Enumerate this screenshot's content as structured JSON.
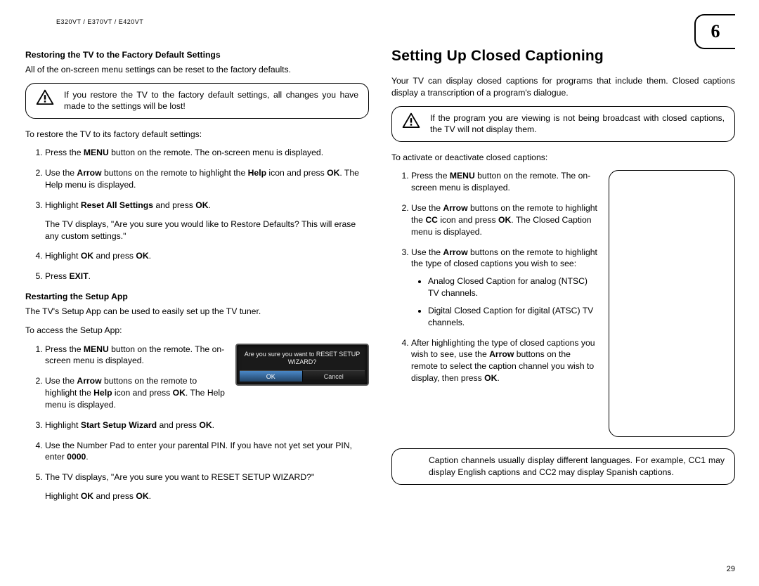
{
  "header": {
    "model": "E320VT / E370VT / E420VT"
  },
  "chapter_number": "6",
  "page_number": "29",
  "left": {
    "sub1": "Restoring the TV to the Factory Default Settings",
    "p1": "All of the on-screen menu settings can be reset to the factory defaults.",
    "warn1": "If you restore the TV to the factory default settings, all changes you have made to the settings will be lost!",
    "p2": "To restore the TV to its factory default settings:",
    "s1_a": "Press the ",
    "s1_menu": "MENU",
    "s1_b": " button on the remote. The on-screen menu is displayed.",
    "s2_a": "Use the ",
    "s2_arrow": "Arrow",
    "s2_b": " buttons on the remote to highlight the ",
    "s2_help": "Help",
    "s2_c": " icon and press ",
    "s2_ok": "OK",
    "s2_d": ". The Help menu is displayed.",
    "s3_a": "Highlight ",
    "s3_reset": "Reset All Settings",
    "s3_b": " and press ",
    "s3_ok": "OK",
    "s3_c": ".",
    "s3_sub": "The TV displays, \"Are you sure you would like to Restore Defaults? This will erase any custom settings.\"",
    "s4_a": "Highlight ",
    "s4_ok1": "OK",
    "s4_b": " and press ",
    "s4_ok2": "OK",
    "s4_c": ".",
    "s5_a": "Press ",
    "s5_exit": "EXIT",
    "s5_b": ".",
    "sub2": "Restarting the Setup App",
    "p3": "The TV's Setup App can be used to easily set up the TV tuner.",
    "p4": "To access the Setup App:",
    "r1_a": "Press the ",
    "r1_menu": "MENU",
    "r1_b": " button on the remote. The on-screen menu is displayed.",
    "r2_a": "Use the ",
    "r2_arrow": "Arrow",
    "r2_b": " buttons on the remote to highlight the ",
    "r2_help": "Help",
    "r2_c": " icon and press ",
    "r2_ok": "OK",
    "r2_d": ". The Help menu is displayed.",
    "r3_a": "Highlight ",
    "r3_start": "Start Setup Wizard",
    "r3_b": " and press ",
    "r3_ok": "OK",
    "r3_c": ".",
    "r4_a": "Use the Number Pad to enter your parental PIN. If you have not yet set your PIN, enter ",
    "r4_pin": "0000",
    "r4_b": ".",
    "r5_a": "The TV displays, \"Are you sure you want to RESET SETUP WIZARD?\"",
    "r5_sub_a": "Highlight ",
    "r5_ok1": "OK",
    "r5_sub_b": " and press ",
    "r5_ok2": "OK",
    "r5_sub_c": "."
  },
  "dialog": {
    "question": "Are you sure you want to RESET SETUP WIZARD?",
    "ok": "OK",
    "cancel": "Cancel"
  },
  "right": {
    "title": "Setting Up Closed Captioning",
    "p1": "Your TV can display closed captions for programs that include them. Closed captions display a transcription of a program's dialogue.",
    "warn1": "If the program you are viewing is not being broadcast with closed captions, the TV will not display them.",
    "p2": "To activate or deactivate closed captions:",
    "c1_a": "Press the ",
    "c1_menu": "MENU",
    "c1_b": " button on the remote. The on-screen menu is displayed.",
    "c2_a": "Use the ",
    "c2_arrow": "Arrow",
    "c2_b": " buttons on the remote to highlight the ",
    "c2_cc": "CC",
    "c2_c": " icon and press ",
    "c2_ok": "OK",
    "c2_d": ". The Closed Caption menu is displayed.",
    "c3_a": "Use the ",
    "c3_arrow": "Arrow",
    "c3_b": " buttons on the remote to highlight the type of closed captions you wish to see:",
    "c3_bul1": "Analog Closed Caption for analog (NTSC) TV channels.",
    "c3_bul2": "Digital Closed Caption for digital (ATSC) TV channels.",
    "c4_a": "After highlighting the type of closed captions you wish to see, use the ",
    "c4_arrow": "Arrow",
    "c4_b": " buttons on the remote to select the caption channel you wish to display, then press ",
    "c4_ok": "OK",
    "c4_c": ".",
    "note": "Caption channels usually display different languages. For example, CC1 may display English captions and CC2 may display Spanish captions."
  }
}
